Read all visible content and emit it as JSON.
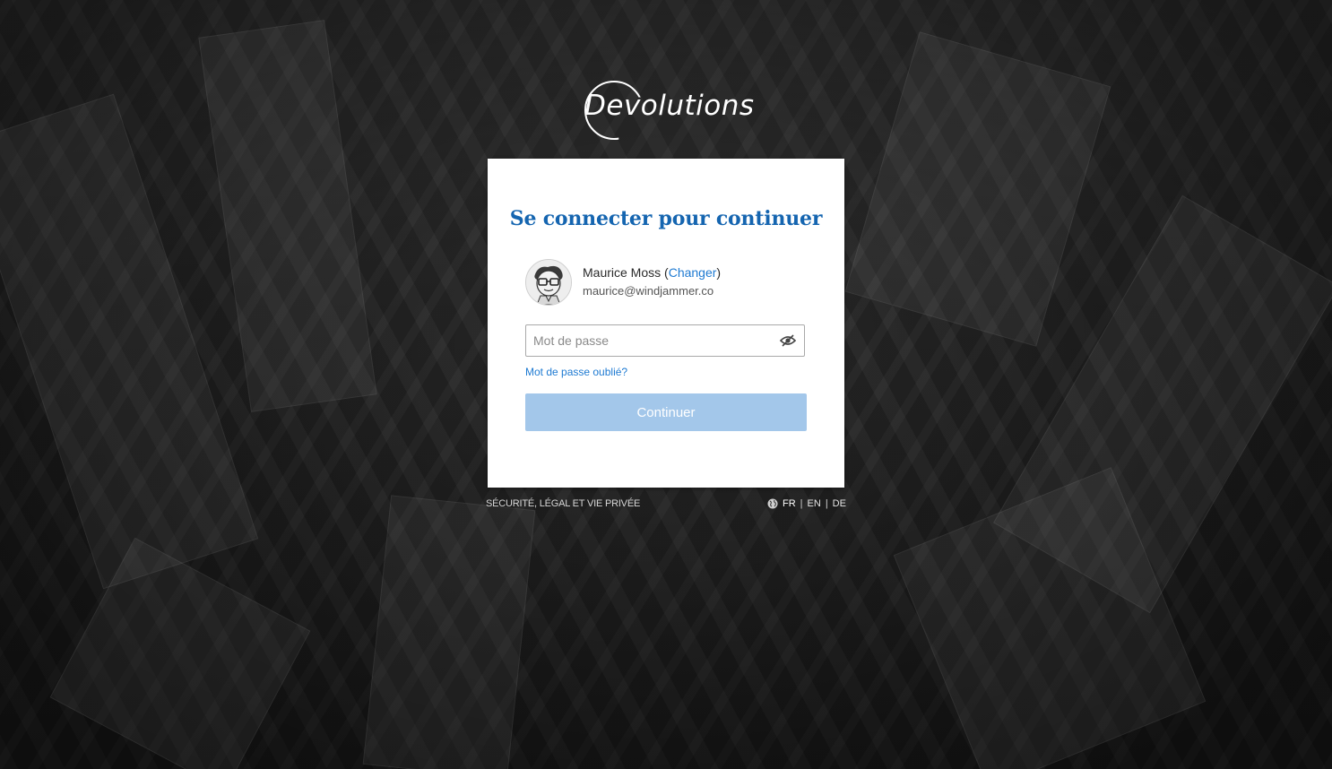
{
  "brand": {
    "logo_text": "Devolutions"
  },
  "card": {
    "title": "Se connecter pour continuer",
    "user": {
      "name": "Maurice Moss",
      "change_label": "Changer",
      "email": "maurice@windjammer.co"
    },
    "password": {
      "placeholder": "Mot de passe",
      "value": ""
    },
    "forgot_label": "Mot de passe oublié?",
    "continue_label": "Continuer"
  },
  "footer": {
    "legal_label": "SÉCURITÉ, LÉGAL ET VIE PRIVÉE",
    "languages": [
      "FR",
      "EN",
      "DE"
    ],
    "separator": "|",
    "active_language": "FR"
  },
  "colors": {
    "accent": "#1565b0",
    "link": "#1e7ad2",
    "button_disabled": "#a3c7ea"
  },
  "icons": {
    "password_toggle": "eye-slash-icon",
    "language": "globe-icon",
    "avatar": "user-avatar"
  }
}
